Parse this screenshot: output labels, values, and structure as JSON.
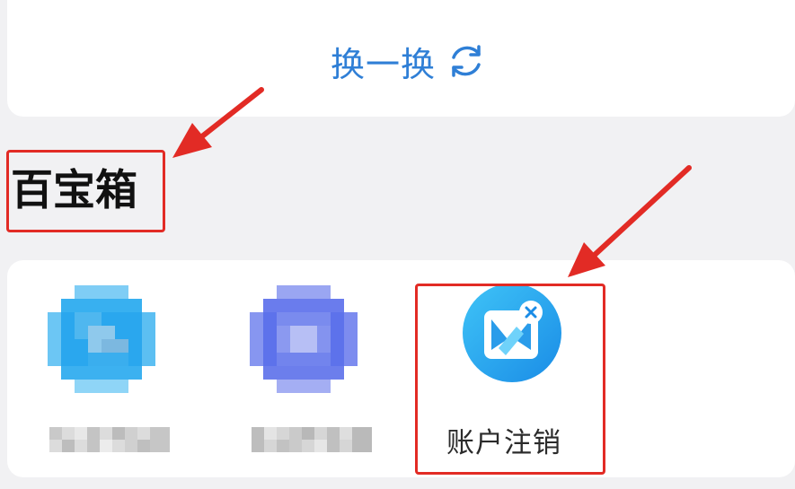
{
  "refresh": {
    "label": "换一换",
    "icon": "refresh-icon"
  },
  "section": {
    "title": "百宝箱"
  },
  "tools": {
    "items": [
      {
        "icon": "blurred-app-icon-1",
        "label": "",
        "blurred": true
      },
      {
        "icon": "blurred-app-icon-2",
        "label": "",
        "blurred": true
      },
      {
        "icon": "account-cancel-icon",
        "label": "账户注销",
        "blurred": false
      }
    ]
  },
  "colors": {
    "accent": "#2f7fd6",
    "highlight": "#e22b25",
    "background": "#f1f1f3",
    "card": "#ffffff"
  }
}
